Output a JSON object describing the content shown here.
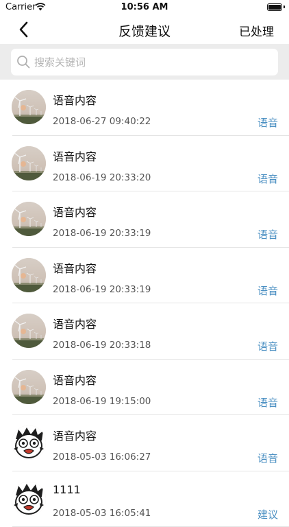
{
  "status_bar": {
    "carrier": "Carrier",
    "time": "10:56 AM"
  },
  "nav": {
    "title": "反馈建议",
    "action": "已处理"
  },
  "search": {
    "placeholder": "搜索关键词",
    "value": ""
  },
  "items": [
    {
      "title": "语音内容",
      "date": "2018-06-27 09:40:22",
      "type": "语音",
      "avatar": "wind-turbine-avatar"
    },
    {
      "title": "语音内容",
      "date": "2018-06-19 20:33:20",
      "type": "语音",
      "avatar": "wind-turbine-avatar"
    },
    {
      "title": "语音内容",
      "date": "2018-06-19 20:33:19",
      "type": "语音",
      "avatar": "wind-turbine-avatar"
    },
    {
      "title": "语音内容",
      "date": "2018-06-19 20:33:19",
      "type": "语音",
      "avatar": "wind-turbine-avatar"
    },
    {
      "title": "语音内容",
      "date": "2018-06-19 20:33:18",
      "type": "语音",
      "avatar": "wind-turbine-avatar"
    },
    {
      "title": "语音内容",
      "date": "2018-06-19 19:15:00",
      "type": "语音",
      "avatar": "wind-turbine-avatar"
    },
    {
      "title": "语音内容",
      "date": "2018-05-03 16:06:27",
      "type": "语音",
      "avatar": "cartoon-face-avatar"
    },
    {
      "title": "1111",
      "date": "2018-05-03 16:05:41",
      "type": "建议",
      "avatar": "cartoon-face-avatar"
    }
  ],
  "colors": {
    "accent": "#4a8fc2",
    "search_bg": "#ececec"
  }
}
